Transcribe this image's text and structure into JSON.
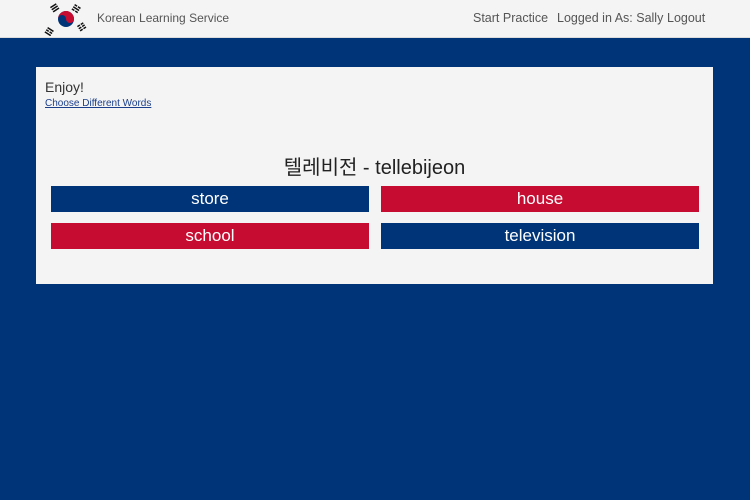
{
  "navbar": {
    "brand": "Korean Learning Service",
    "links": {
      "start_practice": "Start Practice",
      "logged_in": "Logged in As: Sally",
      "logout": "Logout"
    },
    "logo_icon": "korean-flag-icon"
  },
  "main": {
    "greeting": "Enjoy!",
    "choose_link": "Choose Different Words",
    "question": {
      "hangul": "텔레비전",
      "separator": " - ",
      "romanization": "tellebijeon"
    },
    "answers": [
      {
        "label": "store",
        "color": "#003478"
      },
      {
        "label": "house",
        "color": "#c60c30"
      },
      {
        "label": "school",
        "color": "#c60c30"
      },
      {
        "label": "television",
        "color": "#003478"
      }
    ]
  },
  "colors": {
    "page_background": "#003478",
    "blue": "#003478",
    "red": "#c60c30",
    "panel": "#f4f4f4"
  }
}
